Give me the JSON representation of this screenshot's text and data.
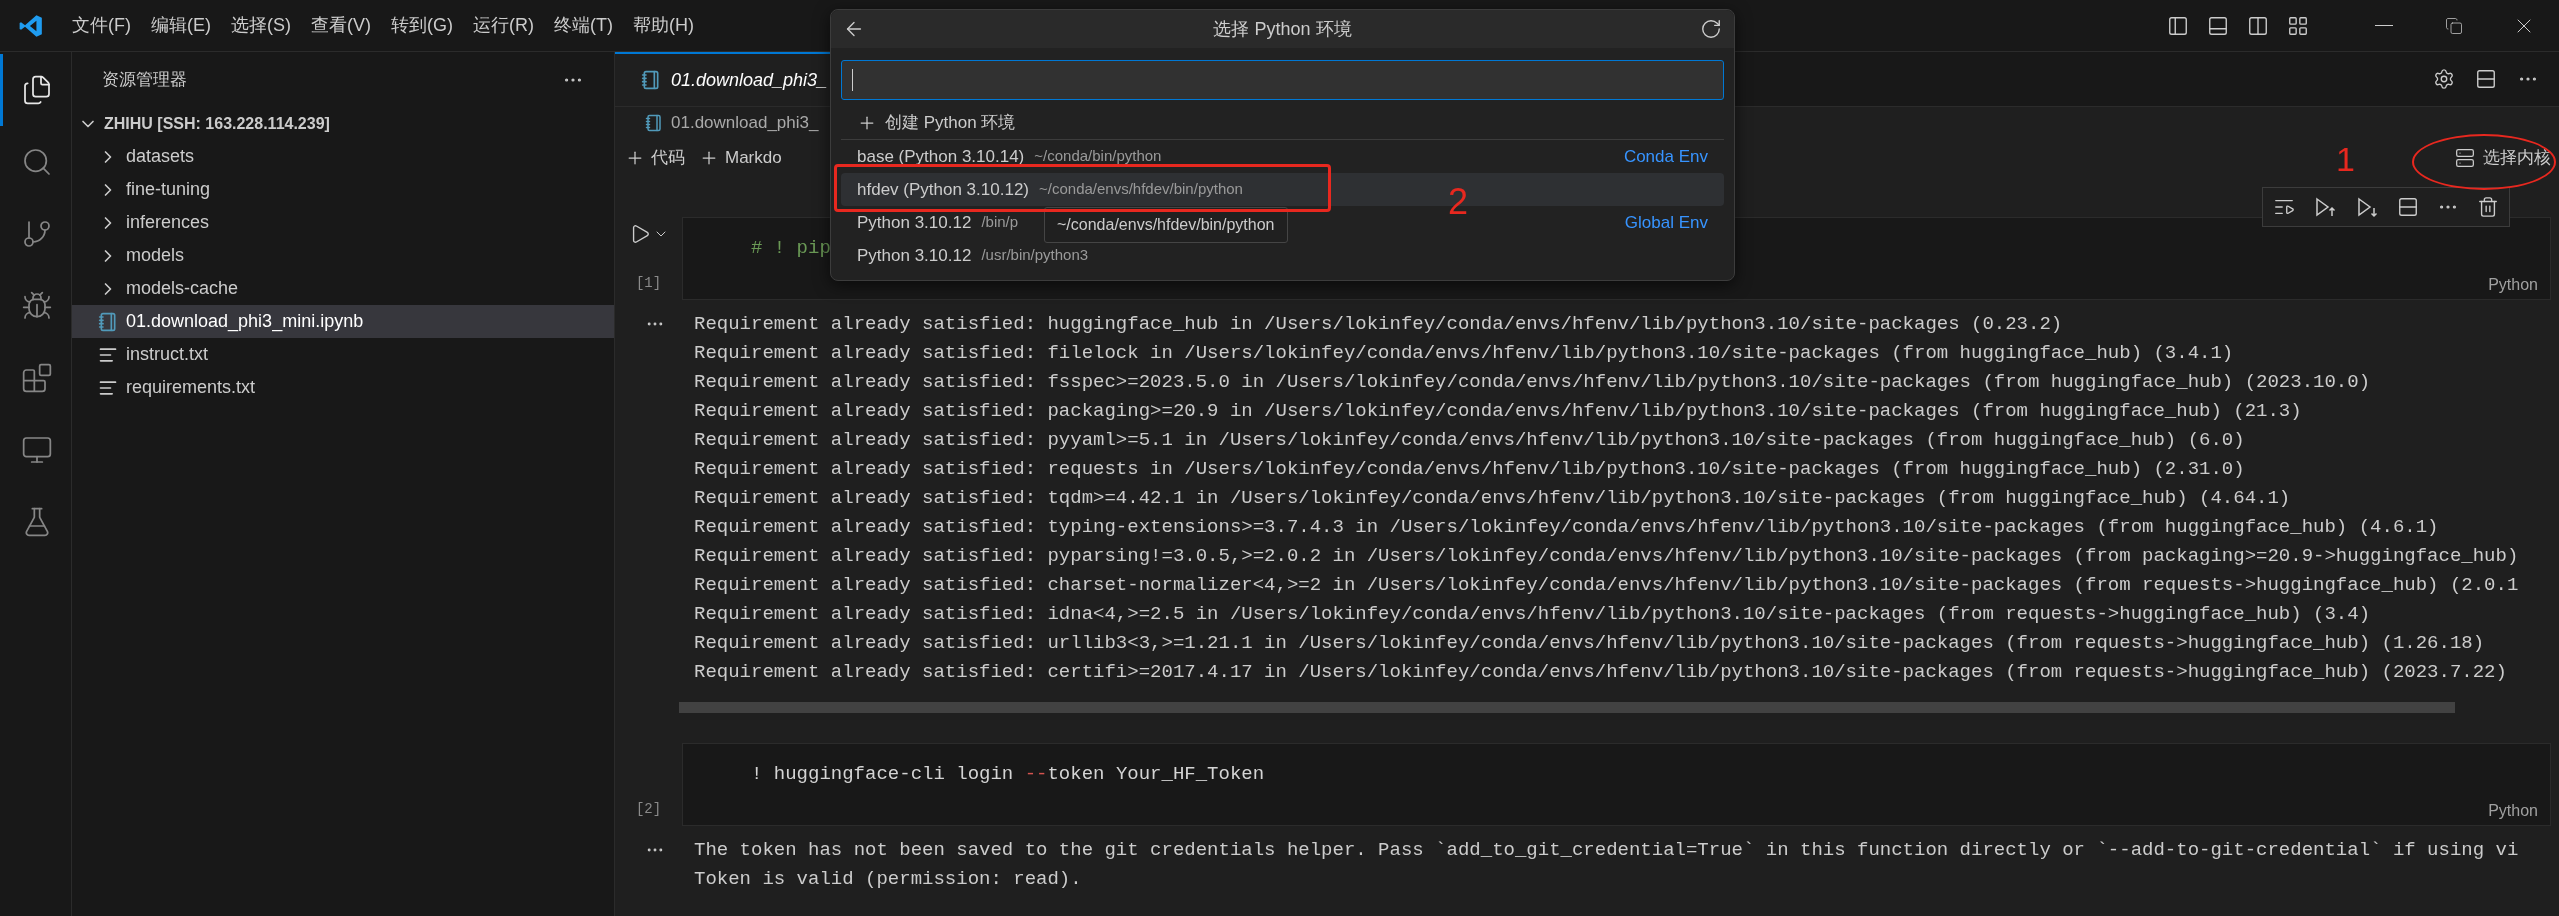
{
  "title_bar": {
    "menu": [
      "文件(F)",
      "编辑(E)",
      "选择(S)",
      "查看(V)",
      "转到(G)",
      "运行(R)",
      "终端(T)",
      "帮助(H)"
    ]
  },
  "activity_bar": [
    {
      "kind": "explorer",
      "selected": true
    },
    {
      "kind": "search",
      "selected": false
    },
    {
      "kind": "source_control",
      "selected": false
    },
    {
      "kind": "run_debug",
      "selected": false
    },
    {
      "kind": "extensions",
      "selected": false
    },
    {
      "kind": "remote",
      "selected": false
    },
    {
      "kind": "testing",
      "selected": false
    }
  ],
  "sidebar": {
    "title": "资源管理器",
    "root": {
      "label": "ZHIHU [SSH: 163.228.114.239]",
      "expanded": true,
      "children": [
        {
          "kind": "folder",
          "label": "datasets",
          "expanded": false,
          "selected": false
        },
        {
          "kind": "folder",
          "label": "fine-tuning",
          "expanded": false,
          "selected": false
        },
        {
          "kind": "folder",
          "label": "inferences",
          "expanded": false,
          "selected": false
        },
        {
          "kind": "folder",
          "label": "models",
          "expanded": false,
          "selected": false
        },
        {
          "kind": "folder",
          "label": "models-cache",
          "expanded": false,
          "selected": false
        },
        {
          "kind": "notebook",
          "label": "01.download_phi3_mini.ipynb",
          "selected": true
        },
        {
          "kind": "text",
          "label": "instruct.txt",
          "selected": false
        },
        {
          "kind": "text",
          "label": "requirements.txt",
          "selected": false
        }
      ]
    }
  },
  "editor": {
    "tab": {
      "label": "01.download_phi3_",
      "selected": true
    },
    "breadcrumb": "01.download_phi3_",
    "toolbar": [
      {
        "label": "代码"
      },
      {
        "label": "Markdo"
      }
    ],
    "kernel_button": "选择内核",
    "cells": [
      {
        "exec_count": "[1]",
        "language": "Python",
        "code": [
          {
            "kind": "comment",
            "text": "# ! pip"
          }
        ],
        "output": [
          "Requirement already satisfied: huggingface_hub in /Users/lokinfey/conda/envs/hfenv/lib/python3.10/site-packages (0.23.2)",
          "Requirement already satisfied: filelock in /Users/lokinfey/conda/envs/hfenv/lib/python3.10/site-packages (from huggingface_hub) (3.4.1)",
          "Requirement already satisfied: fsspec>=2023.5.0 in /Users/lokinfey/conda/envs/hfenv/lib/python3.10/site-packages (from huggingface_hub) (2023.10.0)",
          "Requirement already satisfied: packaging>=20.9 in /Users/lokinfey/conda/envs/hfenv/lib/python3.10/site-packages (from huggingface_hub) (21.3)",
          "Requirement already satisfied: pyyaml>=5.1 in /Users/lokinfey/conda/envs/hfenv/lib/python3.10/site-packages (from huggingface_hub) (6.0)",
          "Requirement already satisfied: requests in /Users/lokinfey/conda/envs/hfenv/lib/python3.10/site-packages (from huggingface_hub) (2.31.0)",
          "Requirement already satisfied: tqdm>=4.42.1 in /Users/lokinfey/conda/envs/hfenv/lib/python3.10/site-packages (from huggingface_hub) (4.64.1)",
          "Requirement already satisfied: typing-extensions>=3.7.4.3 in /Users/lokinfey/conda/envs/hfenv/lib/python3.10/site-packages (from huggingface_hub) (4.6.1)",
          "Requirement already satisfied: pyparsing!=3.0.5,>=2.0.2 in /Users/lokinfey/conda/envs/hfenv/lib/python3.10/site-packages (from packaging>=20.9->huggingface_hub)",
          "Requirement already satisfied: charset-normalizer<4,>=2 in /Users/lokinfey/conda/envs/hfenv/lib/python3.10/site-packages (from requests->huggingface_hub) (2.0.1",
          "Requirement already satisfied: idna<4,>=2.5 in /Users/lokinfey/conda/envs/hfenv/lib/python3.10/site-packages (from requests->huggingface_hub) (3.4)",
          "Requirement already satisfied: urllib3<3,>=1.21.1 in /Users/lokinfey/conda/envs/hfenv/lib/python3.10/site-packages (from requests->huggingface_hub) (1.26.18)",
          "Requirement already satisfied: certifi>=2017.4.17 in /Users/lokinfey/conda/envs/hfenv/lib/python3.10/site-packages (from requests->huggingface_hub) (2023.7.22)"
        ]
      },
      {
        "exec_count": "[2]",
        "language": "Python",
        "code": [
          {
            "kind": "plain",
            "text": "! huggingface-cli login "
          },
          {
            "kind": "operator",
            "text": "--"
          },
          {
            "kind": "plain",
            "text": "token Your_HF_Token"
          }
        ],
        "output": [
          "The token has not been saved to the git credentials helper. Pass `add_to_git_credential=True` in this function directly or `--add-to-git-credential` if using vi",
          "Token is valid (permission: read)."
        ]
      }
    ]
  },
  "quick_pick": {
    "title": "选择 Python 环境",
    "items": [
      {
        "kind": "action",
        "label": "创建 Python 环境"
      },
      {
        "kind": "env",
        "label": "base (Python 3.10.14)",
        "path": "~/conda/bin/python",
        "tag": "Conda Env",
        "selected": false
      },
      {
        "kind": "env",
        "label": "hfdev (Python 3.10.12)",
        "path": "~/conda/envs/hfdev/bin/python",
        "selected": true
      },
      {
        "kind": "env",
        "label": "Python 3.10.12",
        "path": "/bin/p",
        "tag": "Global Env",
        "selected": false
      },
      {
        "kind": "env",
        "label": "Python 3.10.12",
        "path": "/usr/bin/python3",
        "selected": false
      }
    ],
    "tooltip": "~/conda/envs/hfdev/bin/python"
  },
  "annotations": [
    {
      "kind": "box",
      "label": "2"
    },
    {
      "kind": "ellipse",
      "label": "1"
    }
  ]
}
